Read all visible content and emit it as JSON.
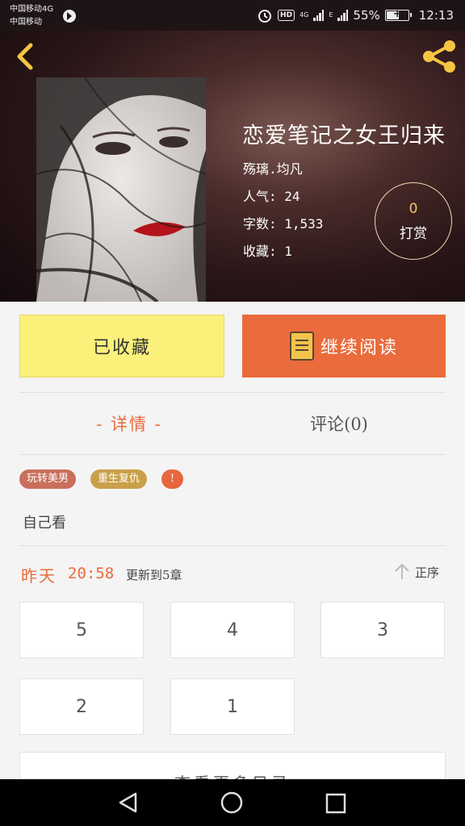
{
  "status_bar": {
    "carrier_1": "中国移动4G",
    "carrier_2": "中国移动",
    "hd_badge": "HD",
    "network_4g": "4G",
    "network_e": "E",
    "battery_percent": "55%",
    "battery_level": 0.55,
    "time": "12:13"
  },
  "book": {
    "title": "恋爱笔记之女王归来",
    "author": "殇璃.均凡",
    "popularity": "人气: 24",
    "word_count": "字数: 1,533",
    "favorites": "收藏: 1",
    "reward_count": "0",
    "reward_label": "打赏"
  },
  "actions": {
    "favorited_label": "已收藏",
    "continue_label": "继续阅读"
  },
  "tabs": {
    "detail": "- 详情 -",
    "comments": "评论(0)"
  },
  "tags": [
    {
      "label": "玩转美男",
      "color": "#c96f5c"
    },
    {
      "label": "重生复仇",
      "color": "#c9a04a"
    },
    {
      "label": "!",
      "color": "#e8663d"
    }
  ],
  "description": "自己看",
  "update": {
    "day": "昨天",
    "time": "20:58",
    "text": "更新到5章",
    "sort_label": "正序"
  },
  "chapters": [
    "5",
    "4",
    "3",
    "2",
    "1"
  ],
  "more_label": "查看更多目录",
  "colors": {
    "accent": "#ea6b3c",
    "favorite_button": "#faf07a",
    "hero_background": "#2a1618"
  },
  "icons": [
    "back-arrow-icon",
    "share-icon",
    "book-icon",
    "sort-arrow-icon",
    "nav-back-icon",
    "nav-home-icon",
    "nav-recent-icon"
  ]
}
